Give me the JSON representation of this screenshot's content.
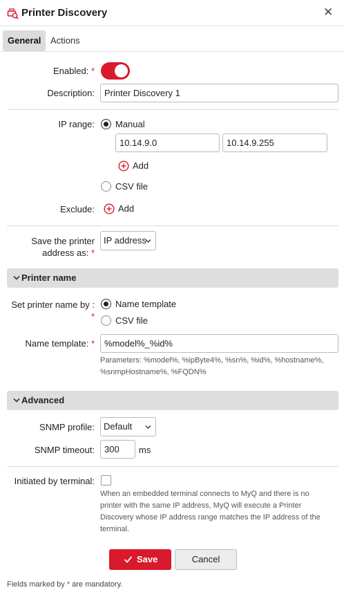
{
  "dialog": {
    "title": "Printer Discovery",
    "close_icon": "close-icon"
  },
  "tabs": [
    {
      "label": "General",
      "active": true
    },
    {
      "label": "Actions",
      "active": false
    }
  ],
  "general": {
    "enabled_label": "Enabled:",
    "enabled": true,
    "description_label": "Description:",
    "description_value": "Printer Discovery 1",
    "ip_range_label": "IP range:",
    "manual_label": "Manual",
    "ip_from": "10.14.9.0",
    "ip_to": "10.14.9.255",
    "add_label": "Add",
    "csv_label": "CSV file",
    "exclude_label": "Exclude:",
    "exclude_add_label": "Add",
    "save_address_label_1": "Save the printer",
    "save_address_label_2": "address as:",
    "save_address_value": "IP address"
  },
  "printer_name": {
    "section_title": "Printer name",
    "set_by_label": "Set printer name by :",
    "name_template_option": "Name template",
    "csv_option": "CSV file",
    "name_template_label": "Name template:",
    "name_template_value": "%model%_%id%",
    "params_line_1": "Parameters: %model%, %ipByte4%, %sn%, %id%, %hostname%,",
    "params_line_2": "%snmpHostname%, %FQDN%"
  },
  "advanced": {
    "section_title": "Advanced",
    "snmp_profile_label": "SNMP profile:",
    "snmp_profile_value": "Default",
    "snmp_timeout_label": "SNMP timeout:",
    "snmp_timeout_value": "300",
    "snmp_timeout_unit": "ms",
    "initiated_label": "Initiated by terminal:",
    "initiated_checked": false,
    "initiated_hint_1": "When an embedded terminal connects to MyQ and there is no",
    "initiated_hint_2": "printer with the same IP address, MyQ will execute a Printer",
    "initiated_hint_3": "Discovery whose IP address range matches the IP address of the",
    "initiated_hint_4": "terminal."
  },
  "actions": {
    "save_label": "Save",
    "cancel_label": "Cancel"
  },
  "footer": {
    "text_before": "Fields marked by ",
    "asterisk": "*",
    "text_after": " are mandatory."
  },
  "colors": {
    "accent": "#d9192c",
    "section_bg": "#dedede"
  }
}
